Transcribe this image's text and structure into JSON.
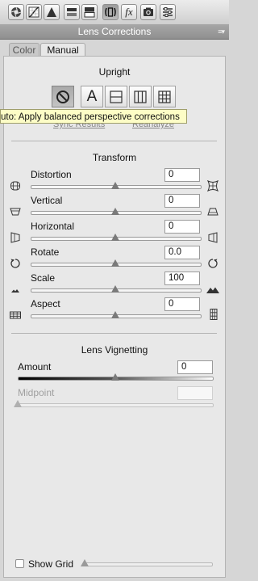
{
  "toolbar": {
    "tabs": [
      {
        "icon": "aperture-icon"
      },
      {
        "icon": "tone-curve-icon"
      },
      {
        "icon": "detail-triangle-icon"
      },
      {
        "icon": "hsl-icon"
      },
      {
        "icon": "split-toning-icon"
      },
      {
        "icon": "lens-corrections-icon",
        "active": true
      },
      {
        "icon": "effects-fx-icon",
        "text": "fx"
      },
      {
        "icon": "camera-calibration-icon"
      },
      {
        "icon": "presets-sliders-icon"
      }
    ]
  },
  "panel": {
    "title": "Lens Corrections",
    "menu_glyph": "≡▾"
  },
  "tabs": [
    {
      "label": "Color",
      "selected": false
    },
    {
      "label": "Manual",
      "selected": true
    }
  ],
  "upright": {
    "title": "Upright",
    "buttons": [
      {
        "icon": "off-circle-slash-icon",
        "active": true
      },
      {
        "icon": "auto-a-icon",
        "text": "A"
      },
      {
        "icon": "level-icon"
      },
      {
        "icon": "vertical-icon"
      },
      {
        "icon": "full-grid-icon"
      }
    ],
    "tooltip": "uto: Apply balanced perspective corrections",
    "sync_results": "Sync Results",
    "reanalyze": "Reanalyze"
  },
  "transform": {
    "title": "Transform",
    "sliders": [
      {
        "label": "Distortion",
        "value": "0",
        "position": 0.5,
        "left_icon": "barrel-icon",
        "right_icon": "pincushion-icon"
      },
      {
        "label": "Vertical",
        "value": "0",
        "position": 0.5,
        "left_icon": "keystone-down-icon",
        "right_icon": "keystone-up-icon"
      },
      {
        "label": "Horizontal",
        "value": "0",
        "position": 0.5,
        "left_icon": "perspective-left-icon",
        "right_icon": "perspective-right-icon"
      },
      {
        "label": "Rotate",
        "value": "0.0",
        "position": 0.5,
        "left_icon": "rotate-ccw-icon",
        "right_icon": "rotate-cw-icon"
      },
      {
        "label": "Scale",
        "value": "100",
        "position": 0.5,
        "left_icon": "mountain-small-icon",
        "right_icon": "mountain-large-icon"
      },
      {
        "label": "Aspect",
        "value": "0",
        "position": 0.5,
        "left_icon": "grid-wide-icon",
        "right_icon": "grid-tall-icon"
      }
    ]
  },
  "vignetting": {
    "title": "Lens Vignetting",
    "amount_label": "Amount",
    "amount_value": "0",
    "amount_position": 0.5,
    "midpoint_label": "Midpoint",
    "midpoint_value": "",
    "midpoint_position": 0.0
  },
  "grid": {
    "label": "Show Grid",
    "checked": false,
    "position": 0.0
  },
  "colors": {
    "panel_bg": "#e8e8e8",
    "outer_bg": "#d6d6d6",
    "header_bg": "#9b9b9b",
    "tooltip_bg": "#fdfdc6"
  }
}
